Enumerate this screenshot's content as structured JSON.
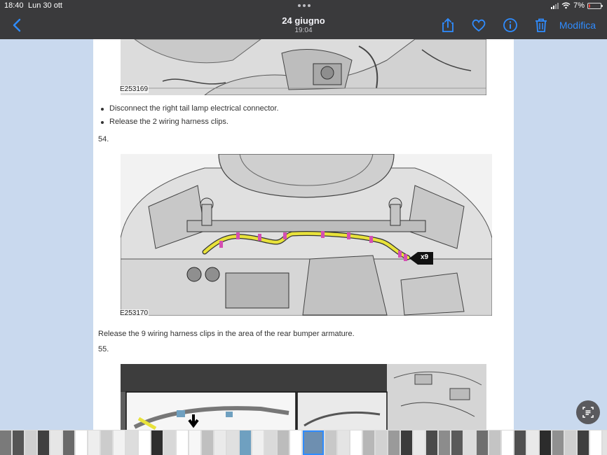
{
  "status": {
    "time": "18:40",
    "date": "Lun 30 ott",
    "battery": "7%"
  },
  "nav": {
    "title": "24 giugno",
    "subtitle": "19:04",
    "edit_label": "Modifica",
    "icons": [
      "chevron-left-icon",
      "share-icon",
      "heart-icon",
      "info-icon",
      "trash-icon"
    ]
  },
  "doc": {
    "fig1_code": "E253169",
    "bullets": [
      "Disconnect the right tail lamp electrical connector.",
      "Release the 2 wiring harness clips."
    ],
    "step54": "54.",
    "fig2_code": "E253170",
    "fig2_callout": "x9",
    "para": "Release the 9 wiring harness clips in the area of the rear bumper armature.",
    "step55": "55."
  },
  "colors": {
    "accent": "#2f8cff",
    "bar": "#3a3a3c",
    "page_bg": "#c9d9ee",
    "harness": "#e8e23a"
  },
  "thumbnails": [
    "#7a7a7a",
    "#555555",
    "#cfcfcf",
    "#404040",
    "#e6e6e6",
    "#6a6a6a",
    "#ffffff",
    "#eeeeee",
    "#cccccc",
    "#f2f2f2",
    "#dddddd",
    "#ffffff",
    "#2e2e2e",
    "#d8d8d8",
    "#ffffff",
    "#f7f7f7",
    "#c0c0c0",
    "#eaeaea",
    "#e0e0e0",
    "#6fa0c0",
    "#f0f0f0",
    "#dadada",
    "#bcbcbc",
    "#ffffff",
    "#6e8fb0",
    "#c8c8c8",
    "#e4e4e4",
    "#ffffff",
    "#b7b7b7",
    "#d2d2d2",
    "#9a9a9a",
    "#3b3b3b",
    "#e8e8e8",
    "#4a4a4a",
    "#8c8c8c",
    "#5a5a5a",
    "#dcdcdc",
    "#6f6f6f",
    "#c4c4c4",
    "#ffffff",
    "#505050",
    "#e9e9e9",
    "#2c2c2c",
    "#909090",
    "#cfcfcf",
    "#3f3f3f",
    "#ffffff",
    "#e2e2e2",
    "#f4f4f4",
    "#ececec",
    "#7f7f7f",
    "#d6d6d6",
    "#555555",
    "#ffffff"
  ]
}
